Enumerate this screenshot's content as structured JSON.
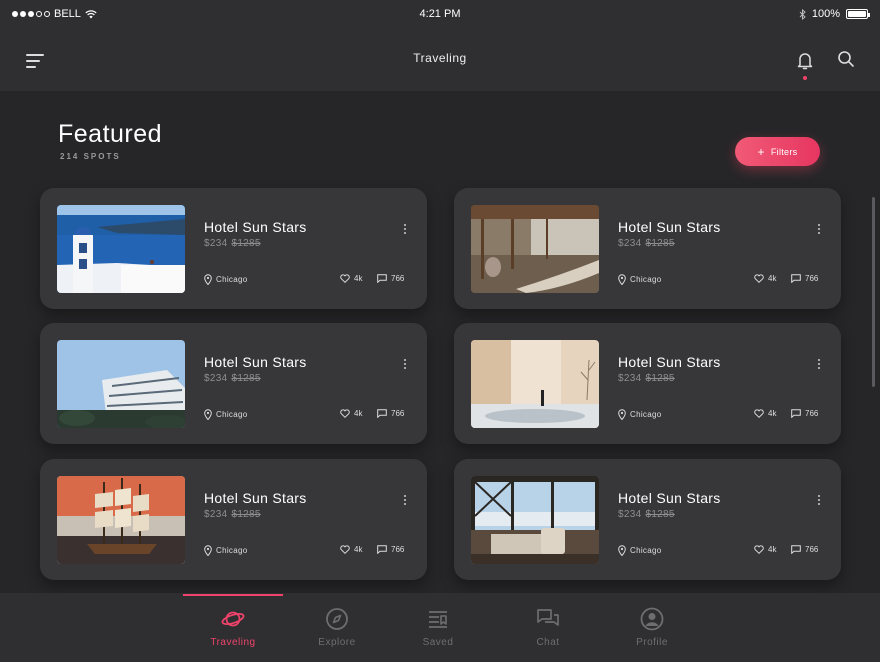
{
  "status_bar": {
    "carrier": "BELL",
    "time": "4:21 PM",
    "battery": "100%"
  },
  "nav": {
    "title": "Traveling"
  },
  "header": {
    "title": "Featured",
    "subtitle": "214 SPOTS",
    "filters_label": "Filters"
  },
  "cards": [
    {
      "name": "Hotel Sun Stars",
      "price": "$234",
      "old_price": "$1285",
      "location": "Chicago",
      "likes": "4k",
      "comments": "766",
      "image": "santorini"
    },
    {
      "name": "Hotel Sun Stars",
      "price": "$234",
      "old_price": "$1285",
      "location": "Chicago",
      "likes": "4k",
      "comments": "766",
      "image": "hammock-terrace"
    },
    {
      "name": "Hotel Sun Stars",
      "price": "$234",
      "old_price": "$1285",
      "location": "Chicago",
      "likes": "4k",
      "comments": "766",
      "image": "modern-building"
    },
    {
      "name": "Hotel Sun Stars",
      "price": "$234",
      "old_price": "$1285",
      "location": "Chicago",
      "likes": "4k",
      "comments": "766",
      "image": "beige-pool"
    },
    {
      "name": "Hotel Sun Stars",
      "price": "$234",
      "old_price": "$1285",
      "location": "Chicago",
      "likes": "4k",
      "comments": "766",
      "image": "ship-model"
    },
    {
      "name": "Hotel Sun Stars",
      "price": "$234",
      "old_price": "$1285",
      "location": "Chicago",
      "likes": "4k",
      "comments": "766",
      "image": "window-lounge"
    }
  ],
  "tabs": [
    {
      "label": "Traveling",
      "icon": "planet-icon",
      "active": true
    },
    {
      "label": "Explore",
      "icon": "compass-icon",
      "active": false
    },
    {
      "label": "Saved",
      "icon": "bookmark-list-icon",
      "active": false
    },
    {
      "label": "Chat",
      "icon": "chat-bubbles-icon",
      "active": false
    },
    {
      "label": "Profile",
      "icon": "profile-icon",
      "active": false
    }
  ],
  "colors": {
    "accent": "#f0436b",
    "background": "#262628",
    "card": "#373739"
  }
}
